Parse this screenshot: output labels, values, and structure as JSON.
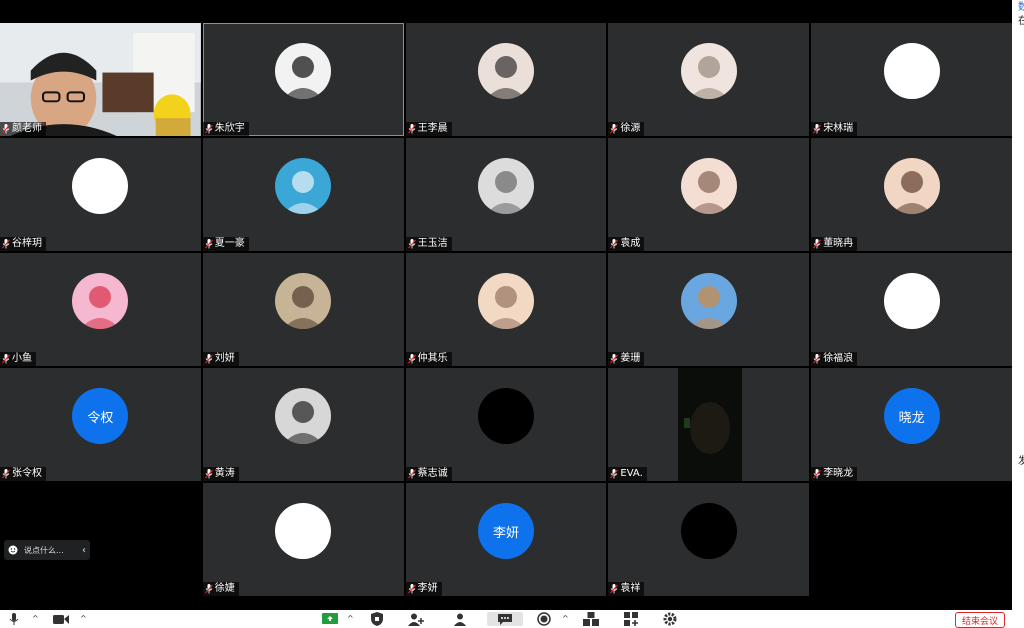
{
  "participants": [
    {
      "name": "颜老师",
      "video": "camera-teacher",
      "host": true
    },
    {
      "name": "朱欣宇",
      "video": "avatar-photo",
      "active": true
    },
    {
      "name": "王李晨",
      "video": "avatar-photo"
    },
    {
      "name": "徐源",
      "video": "avatar-photo"
    },
    {
      "name": "宋林瑞",
      "video": "avatar-photo"
    },
    {
      "name": "谷梓玥",
      "video": "avatar-white"
    },
    {
      "name": "夏一豪",
      "video": "avatar-photo"
    },
    {
      "name": "王玉洁",
      "video": "avatar-photo"
    },
    {
      "name": "袁成",
      "video": "avatar-photo"
    },
    {
      "name": "董晓冉",
      "video": "avatar-photo"
    },
    {
      "name": "小鱼",
      "video": "avatar-photo"
    },
    {
      "name": "刘妍",
      "video": "avatar-photo"
    },
    {
      "name": "仲其乐",
      "video": "avatar-photo"
    },
    {
      "name": "姜珊",
      "video": "avatar-photo"
    },
    {
      "name": "徐福浪",
      "video": "avatar-photo"
    },
    {
      "name": "张令权",
      "video": "initials",
      "initials": "令权"
    },
    {
      "name": "黄涛",
      "video": "avatar-photo"
    },
    {
      "name": "蔡志诚",
      "video": "avatar-photo"
    },
    {
      "name": "EVA.",
      "video": "camera-dark"
    },
    {
      "name": "李晓龙",
      "video": "initials",
      "initials": "晓龙"
    },
    {
      "name": "",
      "video": "empty"
    },
    {
      "name": "徐婕",
      "video": "avatar-photo"
    },
    {
      "name": "李妍",
      "video": "initials",
      "initials": "李妍"
    },
    {
      "name": "袁祥",
      "video": "avatar-photo"
    },
    {
      "name": "",
      "video": "empty"
    }
  ],
  "chat": {
    "placeholder": "说点什么..."
  },
  "toolbar": {
    "end_label": "结束会议"
  },
  "side_panel": {
    "line1": "数",
    "line2": "在",
    "line3": "发"
  },
  "colors": {
    "accent": "#0e72ed",
    "active_border": "#2fcc52",
    "end_red": "#e02828",
    "tile_bg": "#2b2d2f"
  }
}
